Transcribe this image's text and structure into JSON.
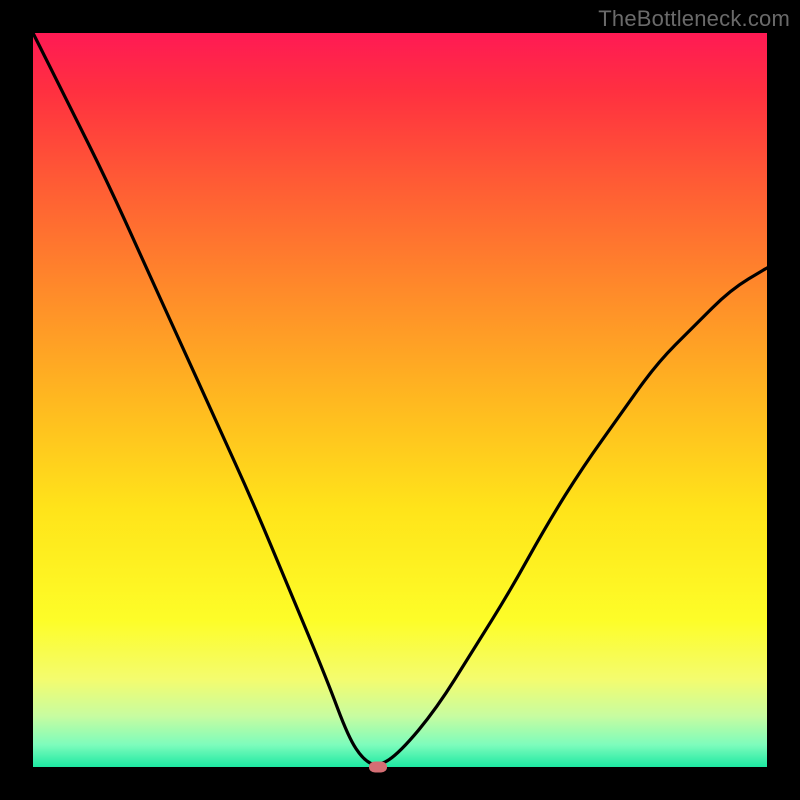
{
  "watermark": "TheBottleneck.com",
  "chart_data": {
    "type": "line",
    "title": "",
    "xlabel": "",
    "ylabel": "",
    "xlim": [
      0,
      100
    ],
    "ylim": [
      0,
      100
    ],
    "grid": false,
    "legend": false,
    "series": [
      {
        "name": "bottleneck-curve",
        "x": [
          0,
          5,
          10,
          15,
          20,
          25,
          30,
          35,
          40,
          43,
          45,
          47,
          50,
          55,
          60,
          65,
          70,
          75,
          80,
          85,
          90,
          95,
          100
        ],
        "values": [
          100,
          90,
          80,
          69,
          58,
          47,
          36,
          24,
          12,
          4,
          1,
          0,
          2,
          8,
          16,
          24,
          33,
          41,
          48,
          55,
          60,
          65,
          68
        ]
      }
    ],
    "marker": {
      "x": 47,
      "y": 0
    },
    "gradient_stops": [
      {
        "pos": 0,
        "color": "#ff1a54"
      },
      {
        "pos": 50,
        "color": "#ffe41a"
      },
      {
        "pos": 100,
        "color": "#1de9a2"
      }
    ]
  }
}
